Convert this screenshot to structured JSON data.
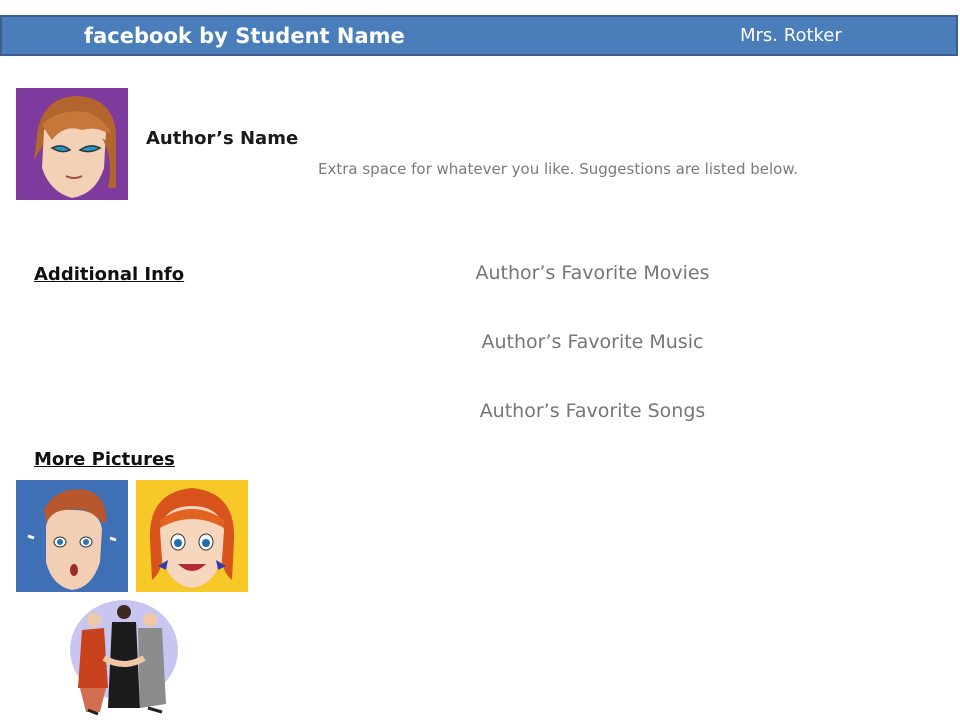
{
  "header": {
    "title": "facebook by Student Name",
    "teacher": "Mrs. Rotker",
    "bg_color": "#4a7ebb"
  },
  "profile": {
    "author_name": "Author’s Name",
    "extra_text": "Extra space for whatever you like.  Suggestions are listed below.",
    "image_icon": "girl-portrait-icon"
  },
  "sections": {
    "additional_info": "Additional Info",
    "more_pictures": "More Pictures"
  },
  "favorites": [
    "Author’s Favorite Movies",
    "Author’s Favorite Music",
    "Author’s Favorite Songs"
  ],
  "pictures": [
    {
      "icon": "boy-crying-icon",
      "bg": "#3f6fb4"
    },
    {
      "icon": "girl-smiling-icon",
      "bg": "#f6c928"
    },
    {
      "icon": "wedding-couple-icon",
      "bg": "#c8c6f0"
    }
  ]
}
